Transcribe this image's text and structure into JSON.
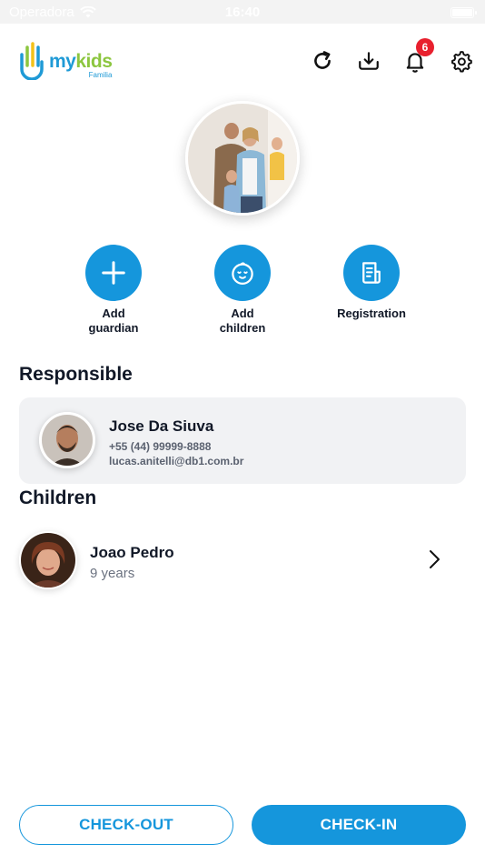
{
  "status_bar": {
    "carrier": "Operadora",
    "time": "16:40"
  },
  "header": {
    "logo": {
      "my": "my",
      "kids": "kids",
      "sub": "Familia"
    },
    "notifications_count": "6"
  },
  "actions": [
    {
      "label": "Add\nguardian",
      "icon": "plus-icon"
    },
    {
      "label": "Add\nchildren",
      "icon": "baby-face-icon"
    },
    {
      "label": "Registration",
      "icon": "document-icon"
    }
  ],
  "responsible": {
    "title": "Responsible",
    "name": "Jose Da Siuva",
    "phone": "+55 (44) 99999-8888",
    "email": "lucas.anitelli@db1.com.br"
  },
  "children": {
    "title": "Children",
    "items": [
      {
        "name": "Joao Pedro",
        "age": "9 years"
      }
    ]
  },
  "buttons": {
    "checkout": "CHECK-OUT",
    "checkin": "CHECK-IN"
  },
  "colors": {
    "primary": "#1596dc",
    "badge": "#e8202e",
    "logo_green": "#8cc63f"
  }
}
